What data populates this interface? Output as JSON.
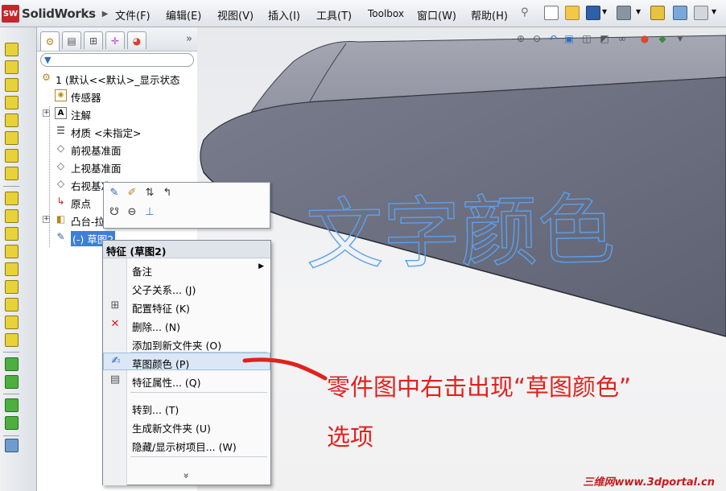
{
  "app": {
    "name": "SolidWorks",
    "badge": "SW"
  },
  "menu": [
    "文件(F)",
    "编辑(E)",
    "视图(V)",
    "插入(I)",
    "工具(T)",
    "Toolbox",
    "窗口(W)",
    "帮助(H)"
  ],
  "tree": {
    "root": "1 (默认<<默认>_显示状态",
    "items": [
      "传感器",
      "注解",
      "材质 <未指定>",
      "前视基准面",
      "上视基准面",
      "右视基准面",
      "原点",
      "凸台-拉伸",
      "(-) 草图2"
    ]
  },
  "model_text": "文字颜色",
  "context_menu": {
    "title": "特征 (草图2)",
    "items": [
      "备注",
      "父子关系... (J)",
      "配置特征 (K)",
      "删除... (N)",
      "添加到新文件夹 (O)",
      "草图颜色 (P)",
      "特征属性... (Q)",
      "转到... (T)",
      "生成新文件夹 (U)",
      "隐藏/显示树项目... (W)"
    ],
    "more": "»"
  },
  "annotation": {
    "line1": "零件图中右击出现“草图颜色”",
    "line2": "选项"
  },
  "watermark": "三维网www.3dportal.cn",
  "colors": {
    "highlight": "#dbe7f6",
    "annotation": "#e0211d",
    "model_text": "#4a90e8",
    "part": "#6a6e7e"
  }
}
